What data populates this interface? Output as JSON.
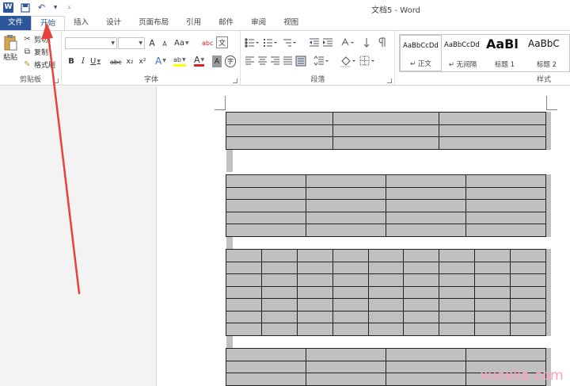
{
  "window": {
    "title": "文档5 - Word"
  },
  "qat": {
    "icons": [
      "word-logo-icon",
      "save-icon",
      "undo-icon",
      "undo-dropdown-icon",
      "customize-qat-icon"
    ]
  },
  "tabs": [
    {
      "label": "文件"
    },
    {
      "label": "开始"
    },
    {
      "label": "插入"
    },
    {
      "label": "设计"
    },
    {
      "label": "页面布局"
    },
    {
      "label": "引用"
    },
    {
      "label": "邮件"
    },
    {
      "label": "审阅"
    },
    {
      "label": "视图"
    }
  ],
  "clipboard": {
    "paste": "粘贴",
    "cut": "剪切",
    "copy": "复制",
    "format_painter": "格式刷",
    "group": "剪贴板"
  },
  "font": {
    "group": "字体",
    "font_name": "",
    "font_size": "",
    "buttons": [
      "A",
      "A",
      "Aa",
      "abc",
      "文",
      "B",
      "I",
      "U",
      "abc",
      "x₂",
      "x²",
      "A",
      "ab",
      "A",
      "A",
      "字"
    ]
  },
  "paragraph": {
    "group": "段落"
  },
  "styles": {
    "group": "样式",
    "items": [
      {
        "sample": "AaBbCcDd",
        "name": "↵ 正文"
      },
      {
        "sample": "AaBbCcDd",
        "name": "↵ 无间隔"
      },
      {
        "sample": "AaBl",
        "name": "标题 1"
      },
      {
        "sample": "AaBbC",
        "name": "标题 2"
      }
    ]
  },
  "colors": {
    "accent": "#2b579a",
    "arrow": "#e8413c",
    "table_fill": "#c0c0c0",
    "watermark": "#ff9fb9"
  },
  "watermark": "xuexila.com"
}
